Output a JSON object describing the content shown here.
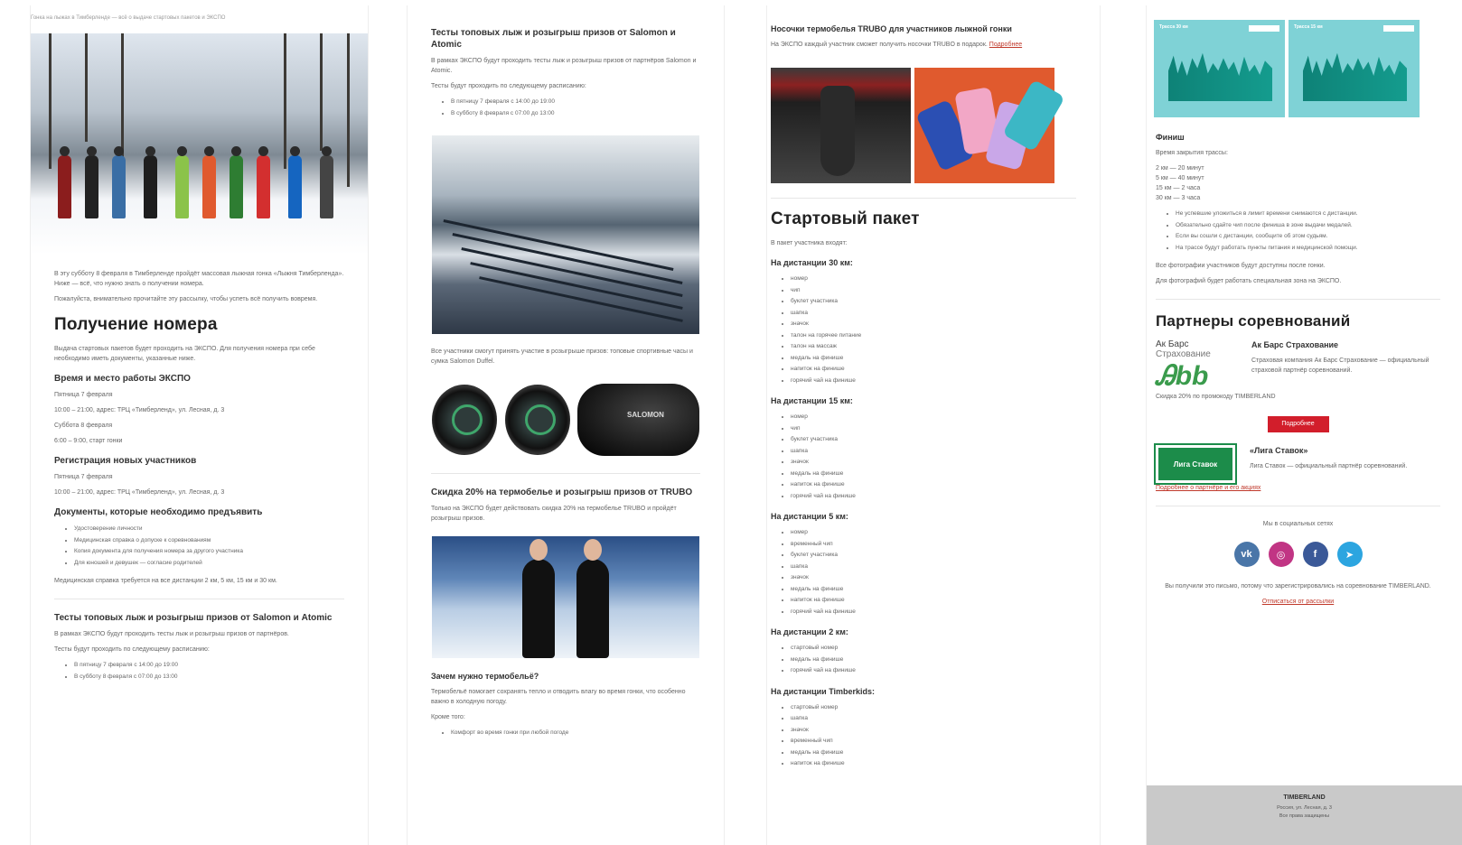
{
  "col1": {
    "breadcrumb": "Гонка на лыжах в Тимберленде — всё о выдаче стартовых пакетов и ЭКСПО",
    "intro1": "В эту субботу 8 февраля в Тимберленде пройдёт массовая лыжная гонка «Лыжня Тимберленда». Ниже — всё, что нужно знать о получении номера.",
    "intro2": "Пожалуйста, внимательно прочитайте эту рассылку, чтобы успеть всё получить вовремя.",
    "title_number": "Получение номера",
    "number_text": "Выдача стартовых пакетов будет проходить на ЭКСПО. Для получения номера при себе необходимо иметь документы, указанные ниже.",
    "expo_title": "Время и место работы ЭКСПО",
    "expo_l1": "Пятница 7 февраля",
    "expo_l2": "10:00 – 21:00, адрес: ТРЦ «Тимберленд», ул. Лесная, д. 3",
    "expo_l3": "Суббота 8 февраля",
    "expo_l4": "6:00 – 9:00, старт гонки",
    "reg_title": "Регистрация новых участников",
    "reg_l1": "Пятница 7 февраля",
    "reg_l2": "10:00 – 21:00, адрес: ТРЦ «Тимберленд», ул. Лесная, д. 3",
    "docs_title": "Документы, которые необходимо предъявить",
    "docs": [
      "Удостоверение личности",
      "Медицинская справка о допуске к соревнованиям",
      "Копия документа для получения номера за другого участника",
      "Для юношей и девушек — согласие родителей"
    ],
    "docs_note": "Медицинская справка требуется на все дистанции 2 км, 5 км, 15 км и 30 км.",
    "tests_title": "Тесты топовых лыж и розыгрыш призов от Salomon и Atomic",
    "tests_text": "В рамках ЭКСПО будут проходить тесты лыж и розыгрыш призов от партнёров.",
    "tests_note": "Тесты будут проходить по следующему расписанию:",
    "tests_items": [
      "В пятницу 7 февраля с 14:00 до 19:00",
      "В субботу 8 февраля с 07:00 до 13:00"
    ]
  },
  "col2": {
    "tests_title": "Тесты топовых лыж и розыгрыш призов от Salomon и Atomic",
    "tests_text": "В рамках ЭКСПО будут проходить тесты лыж и розыгрыш призов от партнёров Salomon и Atomic.",
    "tests_note": "Тесты будут проходить по следующему расписанию:",
    "tests_items": [
      "В пятницу 7 февраля с 14:00 до 19:00",
      "В субботу 8 февраля с 07:00 до 13:00"
    ],
    "prize_text": "Все участники смогут принять участие в розыгрыше призов: топовые спортивные часы и сумка Salomon Duffel.",
    "bag_label": "SALOMON",
    "discount_title": "Скидка 20% на термобелье и розыгрыш призов от TRUBO",
    "discount_text": "Только на ЭКСПО будет действовать скидка 20% на термобелье TRUBO и пройдёт розыгрыш призов.",
    "why_title": "Зачем нужно термобельё?",
    "why_text": "Термобельё помогает сохранять тепло и отводить влагу во время гонки, что особенно важно в холодную погоду.",
    "why_note": "Кроме того:",
    "why_items": [
      "Комфорт во время гонки при любой погоде"
    ]
  },
  "col3": {
    "socks_title": "Носочки термобелья TRUBO для участников лыжной гонки",
    "socks_text": "На ЭКСПО каждый участник сможет получить носочки TRUBO в подарок.",
    "socks_link": "Подробнее",
    "kit_title": "Стартовый пакет",
    "kit_note": "В пакет участника входят:",
    "d30_title": "На дистанции 30 км:",
    "d30": [
      "номер",
      "чип",
      "буклет участника",
      "шапка",
      "значок",
      "талон на горячее питание",
      "талон на массаж",
      "медаль на финише",
      "напиток на финише",
      "горячий чай на финише"
    ],
    "d15_title": "На дистанции 15 км:",
    "d15": [
      "номер",
      "чип",
      "буклет участника",
      "шапка",
      "значок",
      "медаль на финише",
      "напиток на финише",
      "горячий чай на финише"
    ],
    "d5_title": "На дистанции 5 км:",
    "d5": [
      "номер",
      "временный чип",
      "буклет участника",
      "шапка",
      "значок",
      "медаль на финише",
      "напиток на финише",
      "горячий чай на финише"
    ],
    "d2_title": "На дистанции 2 км:",
    "d2": [
      "стартовый номер",
      "медаль на финише",
      "горячий чай на финише"
    ],
    "dk_title": "На дистанции Timberkids:",
    "dk": [
      "стартовый номер",
      "шапка",
      "значок",
      "временный чип",
      "медаль на финише",
      "напиток на финише"
    ]
  },
  "col4": {
    "chart1_label": "Трасса 30 км",
    "chart2_label": "Трасса 15 км",
    "finish_title": "Финиш",
    "finish_note": "Время закрытия трассы:",
    "finish_lines": [
      "2 км — 20 минут",
      "5 км — 40 минут",
      "15 км — 2 часа",
      "30 км — 3 часа"
    ],
    "finish_items": [
      "Не успевшие уложиться в лимит времени снимаются с дистанции.",
      "Обязательно сдайте чип после финиша в зоне выдачи медалей.",
      "Если вы сошли с дистанции, сообщите об этом судьям.",
      "На трассе будут работать пункты питания и медицинской помощи."
    ],
    "finish_t1": "Все фотографии участников будут доступны после гонки.",
    "finish_t2": "Для фотографий будет работать специальная зона на ЭКСПО.",
    "partners_title": "Партнеры соревнований",
    "abs_name1": "Ак Барс",
    "abs_name2": "Страхование",
    "abs_logo": "Ꭿbb",
    "abs_title": "Ак Барс Страхование",
    "abs_text": "Страховая компания Ак Барс Страхование — официальный страховой партнёр соревнований.",
    "abs_more": "Скидка 20% по промокоду TIMBERLAND",
    "more_button": "Подробнее",
    "liga_logo": "Лига Ставок",
    "liga_title": "«Лига Ставок»",
    "liga_text": "Лига Ставок — официальный партнёр соревнований.",
    "liga_link": "Подробнее о партнёре и его акциях",
    "follow_text": "Мы в социальных сетях",
    "social": [
      {
        "name": "vk",
        "label": "vk",
        "color": "#4a76a8"
      },
      {
        "name": "instagram",
        "label": "◎",
        "color": "#c13584"
      },
      {
        "name": "facebook",
        "label": "f",
        "color": "#3b5998"
      },
      {
        "name": "telegram",
        "label": "➤",
        "color": "#2ca5e0"
      }
    ],
    "unsub_text": "Вы получили это письмо, потому что зарегистрировались на соревнование TIMBERLAND.",
    "unsub_link": "Отписаться от рассылки",
    "footer_title": "TIMBERLAND",
    "footer_l1": "Россия, ул. Лесная, д. 3",
    "footer_l2": "Все права защищены"
  }
}
